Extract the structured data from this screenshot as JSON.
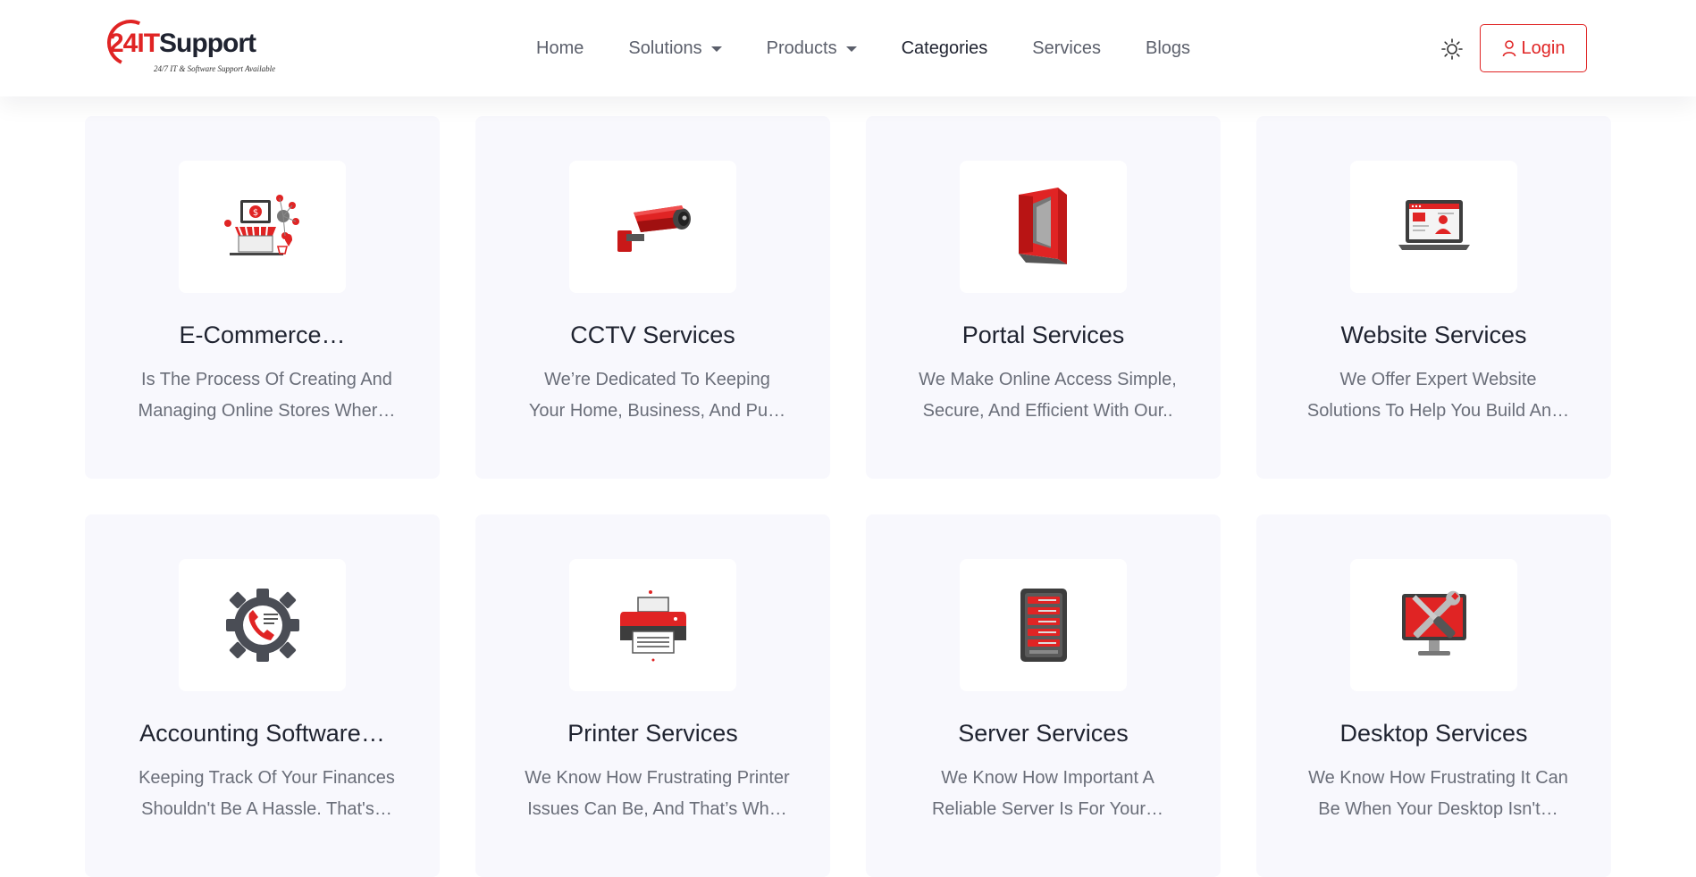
{
  "header": {
    "logo": {
      "brand_24": "24",
      "brand_it": "IT",
      "brand_support": "Support",
      "tagline": "24/7 IT & Software Support Available"
    },
    "nav": [
      {
        "label": "Home",
        "dropdown": false
      },
      {
        "label": "Solutions",
        "dropdown": true
      },
      {
        "label": "Products",
        "dropdown": true
      },
      {
        "label": "Categories",
        "dropdown": false,
        "active": true
      },
      {
        "label": "Services",
        "dropdown": false
      },
      {
        "label": "Blogs",
        "dropdown": false
      }
    ],
    "theme_icon": "sun-icon",
    "login_label": "Login",
    "login_icon": "user-icon"
  },
  "colors": {
    "accent": "#e02424",
    "card_bg": "#f8f8fd",
    "text_dark": "#1f2330",
    "text_muted": "#6a6e79"
  },
  "cards": [
    {
      "title": "E-Commerce…",
      "desc1": "Is The Process Of Creating And",
      "desc2": "Managing Online Stores Wher…",
      "icon": "ecommerce-store-icon"
    },
    {
      "title": "CCTV Services",
      "desc1": "We’re Dedicated To Keeping",
      "desc2": "Your Home, Business, And Pu…",
      "icon": "cctv-camera-icon"
    },
    {
      "title": "Portal Services",
      "desc1": "We Make Online Access Simple,",
      "desc2": "Secure, And Efficient With Our..",
      "icon": "portal-door-icon"
    },
    {
      "title": "Website Services",
      "desc1": "We Offer Expert Website",
      "desc2": "Solutions To Help You Build An…",
      "icon": "laptop-website-icon"
    },
    {
      "title": "Accounting Software…",
      "desc1": "Keeping Track Of Your Finances",
      "desc2": "Shouldn't Be A Hassle. That's…",
      "icon": "gear-phone-icon"
    },
    {
      "title": "Printer Services",
      "desc1": "We Know How Frustrating Printer",
      "desc2": "Issues Can Be, And That’s Wh…",
      "icon": "printer-icon"
    },
    {
      "title": "Server Services",
      "desc1": "We Know How Important A",
      "desc2": "Reliable Server Is For Your…",
      "icon": "server-rack-icon"
    },
    {
      "title": "Desktop Services",
      "desc1": "We Know How Frustrating It Can",
      "desc2": "Be When Your Desktop Isn't…",
      "icon": "desktop-tools-icon"
    }
  ]
}
